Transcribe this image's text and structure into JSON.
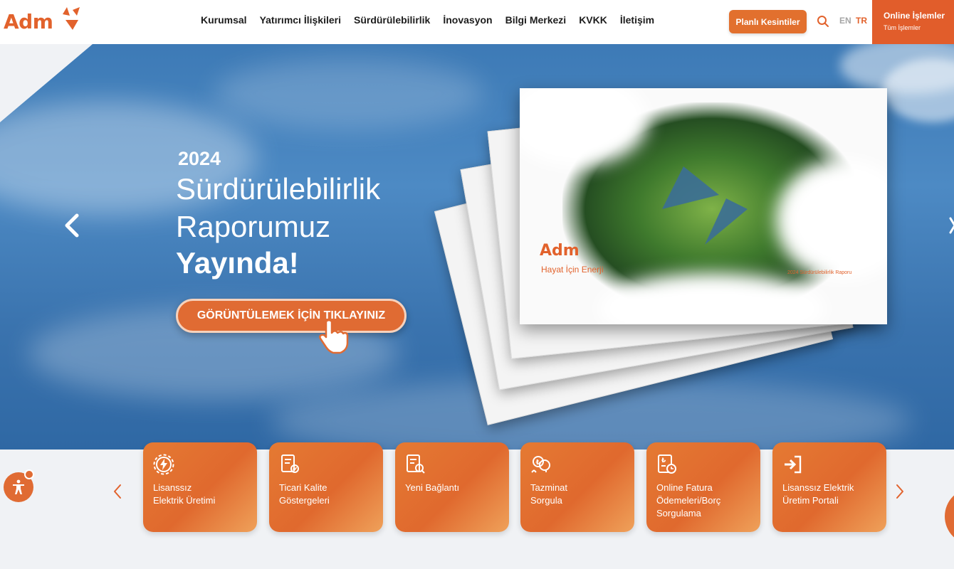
{
  "header": {
    "logo_text": "Adm",
    "nav": [
      "Kurumsal",
      "Yatırımcı İlişkileri",
      "Sürdürülebilirlik",
      "İnovasyon",
      "Bilgi Merkezi",
      "KVKK",
      "İletişim"
    ],
    "planned_button": "Planlı Kesintiler",
    "lang_en": "EN",
    "lang_tr": "TR",
    "online_title": "Online İşlemler",
    "online_sub": "Tüm İşlemler"
  },
  "hero": {
    "year": "2024",
    "line1": "Sürdürülebilirlik",
    "line2": "Raporumuz",
    "line3": "Yayında!",
    "cta": "GÖRÜNTÜLEMEK İÇİN TIKLAYINIZ",
    "cover_logo": "Adm",
    "cover_tagline": "Hayat İçin Enerji",
    "cover_title": "2024 Sürdürülebilirlik Raporu"
  },
  "quick_links": [
    {
      "label": "Lisanssız\nElektrik Üretimi",
      "icon": "gear-bolt-icon"
    },
    {
      "label": "Ticari Kalite\nGöstergeleri",
      "icon": "document-badge-icon"
    },
    {
      "label": "Yeni Bağlantı",
      "icon": "document-search-icon"
    },
    {
      "label": "Tazminat\nSorgula",
      "icon": "money-exchange-icon"
    },
    {
      "label": "Online Fatura\nÖdemeleri/Borç\nSorgulama",
      "icon": "invoice-clock-icon"
    },
    {
      "label": "Lisanssız Elektrik\nÜretim Portali",
      "icon": "login-icon"
    }
  ],
  "colors": {
    "brand": "#e2622c",
    "button": "#e2702e",
    "sky": "#3d7ab6"
  }
}
